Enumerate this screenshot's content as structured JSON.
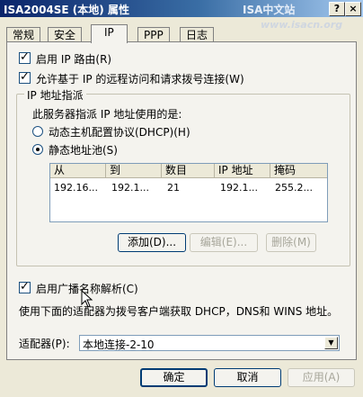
{
  "window": {
    "title": "ISA2004SE (本地) 属性",
    "watermark_top": "ISA中文站",
    "watermark_url": "www.isacn.org",
    "help_button": "?",
    "close_button": "×"
  },
  "tabs": [
    "常规",
    "安全",
    "IP",
    "PPP",
    "日志"
  ],
  "active_tab": "IP",
  "options": {
    "enable_ip_routing": {
      "label": "启用 IP 路由(R)",
      "checked": true
    },
    "allow_ip_remote": {
      "label": "允许基于 IP 的远程访问和请求拨号连接(W)",
      "checked": true
    }
  },
  "ip_assignment": {
    "legend": "IP 地址指派",
    "description": "此服务器指派 IP 地址使用的是:",
    "dhcp_label": "动态主机配置协议(DHCP)(H)",
    "static_label": "静态地址池(S)",
    "selected": "static",
    "columns": [
      "从",
      "到",
      "数目",
      "IP 地址",
      "掩码"
    ],
    "rows": [
      [
        "192.16...",
        "192.1...",
        "21",
        "192.1...",
        "255.2..."
      ]
    ],
    "add_button": "添加(D)...",
    "edit_button": "编辑(E)...",
    "remove_button": "删除(M)"
  },
  "broadcast": {
    "label": "启用广播名称解析(C)",
    "checked": true,
    "description": "使用下面的适配器为拨号客户端获取 DHCP，DNS和 WINS 地址。"
  },
  "adapter": {
    "label": "适配器(P):",
    "value": "本地连接-2-10"
  },
  "footer": {
    "ok": "确定",
    "cancel": "取消",
    "apply": "应用(A)"
  }
}
